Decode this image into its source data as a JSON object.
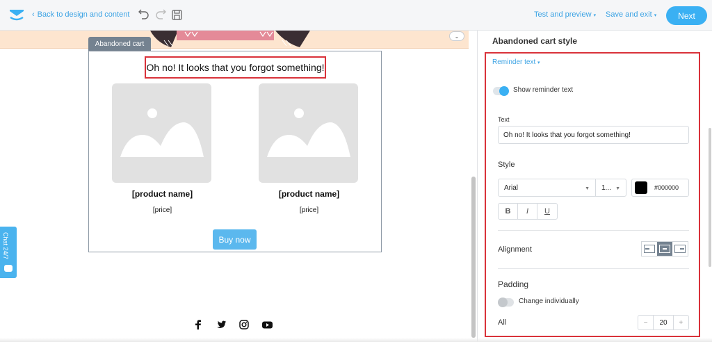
{
  "topbar": {
    "back_label": "Back to design and content",
    "test_label": "Test and preview",
    "save_label": "Save and exit",
    "next_label": "Next"
  },
  "canvas": {
    "block_tag": "Abandoned cart",
    "reminder_text": "Oh no! It looks that you forgot something!",
    "products": [
      {
        "name": "[product name]",
        "price": "[price]"
      },
      {
        "name": "[product name]",
        "price": "[price]"
      }
    ],
    "buy_label": "Buy now",
    "chat_label": "Chat 24/7"
  },
  "panel": {
    "title": "Abandoned cart style",
    "dropdown_label": "Reminder text",
    "show_reminder_label": "Show reminder text",
    "text_label": "Text",
    "text_value": "Oh no! It looks that you forgot something!",
    "style_label": "Style",
    "font_value": "Arial",
    "size_value": "1...",
    "color_hex": "#000000",
    "bold_label": "B",
    "italic_label": "I",
    "underline_label": "U",
    "alignment_label": "Alignment",
    "padding_label": "Padding",
    "change_individually_label": "Change individually",
    "all_label": "All",
    "padding_value": "20",
    "minus": "−",
    "plus": "+"
  },
  "colors": {
    "accent": "#3ab0f3",
    "highlight": "#d9323a",
    "tag": "#748290"
  },
  "icons": [
    "logo-envelope-icon",
    "chevron-left-icon",
    "undo-icon",
    "redo-icon",
    "save-icon",
    "chevron-down-icon",
    "image-placeholder-icon",
    "facebook-icon",
    "twitter-icon",
    "instagram-icon",
    "youtube-icon",
    "chat-bubble-icon",
    "align-left-icon",
    "align-center-icon",
    "align-right-icon"
  ]
}
